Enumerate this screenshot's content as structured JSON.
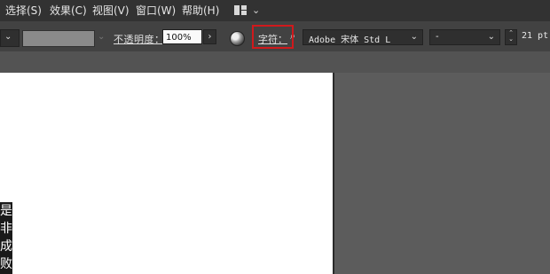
{
  "menubar": {
    "items": [
      {
        "label": "选择(S)"
      },
      {
        "label": "效果(C)"
      },
      {
        "label": "视图(V)"
      },
      {
        "label": "窗口(W)"
      },
      {
        "label": "帮助(H)"
      }
    ],
    "workspace_switcher_icon": "grid-layout-icon",
    "chevron_icon": "chevron-down-icon"
  },
  "controlbar": {
    "opacity_label": "不透明度：",
    "opacity_value": "100%",
    "character_label": "字符：",
    "font_family": "Adobe 宋体 Std L",
    "font_style": "-",
    "font_size": "21 pt",
    "highlight_color": "#d0191c"
  },
  "canvas": {
    "vertical_text": [
      "是",
      "非",
      "成",
      "败"
    ]
  }
}
